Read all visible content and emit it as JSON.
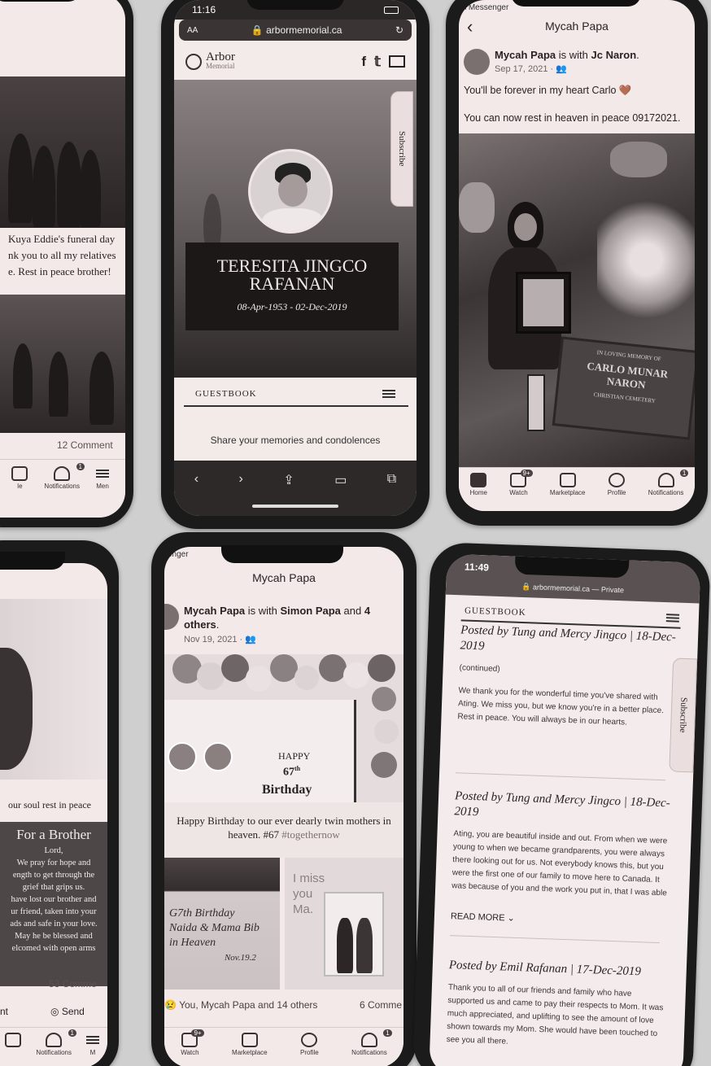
{
  "phone1": {
    "caption": [
      "Kuya Eddie's funeral day",
      "nk you to all my relatives",
      "e. Rest in peace brother!"
    ],
    "comments": "12 Comment",
    "tabs": [
      {
        "label": "le"
      },
      {
        "label": "Notifications",
        "badge": "1"
      },
      {
        "label": "Men"
      }
    ]
  },
  "phone2": {
    "time": "11:16",
    "aa": "AA",
    "url": "arbormemorial.ca",
    "brand_top": "Arbor",
    "brand_bottom": "Memorial",
    "subscribe": "Subscribe",
    "name_line1": "TERESITA JINGCO",
    "name_line2": "RAFANAN",
    "dates": "08-Apr-1953 - 02-Dec-2019",
    "guestbook": "GUESTBOOK",
    "share_text": "Share your memories and condolences"
  },
  "phone3": {
    "back_app": "Messenger",
    "title": "Mycah Papa",
    "author": "Mycah Papa",
    "with_text": " is with ",
    "with_name": "Jc Naron",
    "date": "Sep 17, 2021 · ",
    "text1": "You'll be forever in my heart Carlo 🤎",
    "text2": "You can now rest in heaven in peace 09172021.",
    "plaque_line1": "IN LOVING MEMORY OF",
    "plaque_line2": "CARLO MUNAR",
    "plaque_line3": "NARON",
    "plaque_line4": "CHRISTIAN CEMETERY",
    "tabs": [
      {
        "label": "Home"
      },
      {
        "label": "Watch",
        "badge": "9+"
      },
      {
        "label": "Marketplace"
      },
      {
        "label": "Profile"
      },
      {
        "label": "Notifications",
        "badge": "1"
      }
    ]
  },
  "phone4": {
    "rip": "our soul rest in peace",
    "poem_title": "For a Brother",
    "poem": [
      "Lord,",
      "We pray for hope and",
      "ength to get through the",
      "grief that grips us.",
      "have lost our brother and",
      "ur friend, taken into your",
      "ads and safe in your love.",
      "May he be blessed and",
      "elcomed with open arms"
    ],
    "comments": "53 Comme",
    "left_action": "nt",
    "send": "Send",
    "tabs": [
      {
        "label": ""
      },
      {
        "label": "Notifications",
        "badge": "1"
      },
      {
        "label": "M"
      }
    ]
  },
  "phone5": {
    "back_app": "enger",
    "title": "Mycah Papa",
    "author": "Mycah Papa",
    "with_text": " is with ",
    "with_name": "Simon Papa",
    "and_text": " and ",
    "others": "4 others",
    "date": "Nov 19, 2021 · ",
    "banner_happy": "HAPPY",
    "banner_num": "67",
    "banner_sup": "th",
    "banner_word": "Birthday",
    "caption1": "Happy Birthday to our ever dearly twin mothers in heaven. #67 ",
    "hashtag": "#togethernow",
    "cake_text": [
      "G7th Birthday",
      "Naida & Mama Bib",
      "in Heaven",
      "Nov.19.2"
    ],
    "miss_text": [
      "I miss",
      "you",
      "Ma."
    ],
    "reactions": "You, Mycah Papa and 14 others",
    "comments": "6 Comme",
    "tabs": [
      {
        "label": "Watch",
        "badge": "9+"
      },
      {
        "label": "Marketplace"
      },
      {
        "label": "Profile"
      },
      {
        "label": "Notifications",
        "badge": "1"
      }
    ]
  },
  "phone6": {
    "time": "11:49",
    "url": "arbormemorial.ca — Private",
    "guestbook": "GUESTBOOK",
    "subscribe": "Subscribe",
    "entries": [
      {
        "title": "Posted by Tung and Mercy Jingco | 18-Dec-2019",
        "body": "(continued)",
        "body2": "We thank you for the wonderful time you've shared with Ating. We miss you, but we know you're in a better place. Rest in peace. You will always be in our hearts."
      },
      {
        "title": "Posted by Tung and Mercy Jingco | 18-Dec-2019",
        "body": "Ating, you are beautiful inside and out. From when we were young to when we became grandparents, you were always there looking out for us. Not everybody knows this, but you were the first one of our family to move here to Canada. It was because of you and the work you put in, that I was able",
        "read_more": "READ MORE"
      },
      {
        "title": "Posted by Emil Rafanan | 17-Dec-2019",
        "body": "Thank you to all of our friends and family who have supported us and came to pay their respects to Mom. It was much appreciated, and uplifting to see the amount of love shown towards my Mom. She would have been touched to see you all there."
      }
    ]
  }
}
